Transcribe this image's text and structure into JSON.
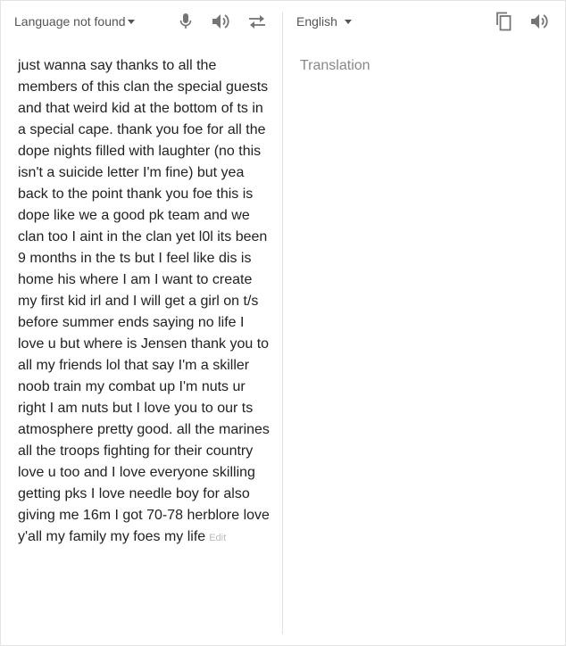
{
  "source": {
    "language_label": "Language not found",
    "text": "just wanna say thanks to all the members of this clan the special guests and that weird kid at the bottom of ts in a special cape. thank you foe for all the dope nights filled with laughter (no this isn't a suicide letter I'm fine) but yea back to the point thank you foe this is dope like we a good pk team and we clan too I aint in the clan yet l0l its been 9 months in the ts but I feel like dis is home his where I am I want to create my first kid irl and I will get a girl on t/s before summer ends saying no life I love u but where is Jensen thank you to all my friends lol that say I'm a skiller noob train my combat up I'm nuts ur right I am nuts but I love you to our ts atmosphere pretty good. all the marines all the troops fighting for their country love u too and I love everyone skilling getting pks I love needle boy for also giving me 16m I got 70-78 herblore love y'all my family my foes my life",
    "edit_label": "Edit",
    "icons": [
      "microphone-icon",
      "speaker-icon",
      "swap-icon"
    ]
  },
  "target": {
    "language_label": "English",
    "placeholder": "Translation",
    "icons": [
      "copy-icon",
      "speaker-icon"
    ]
  },
  "colors": {
    "icon": "#757575",
    "text": "#222222",
    "placeholder": "#888888",
    "edit": "#bbbbbb"
  }
}
